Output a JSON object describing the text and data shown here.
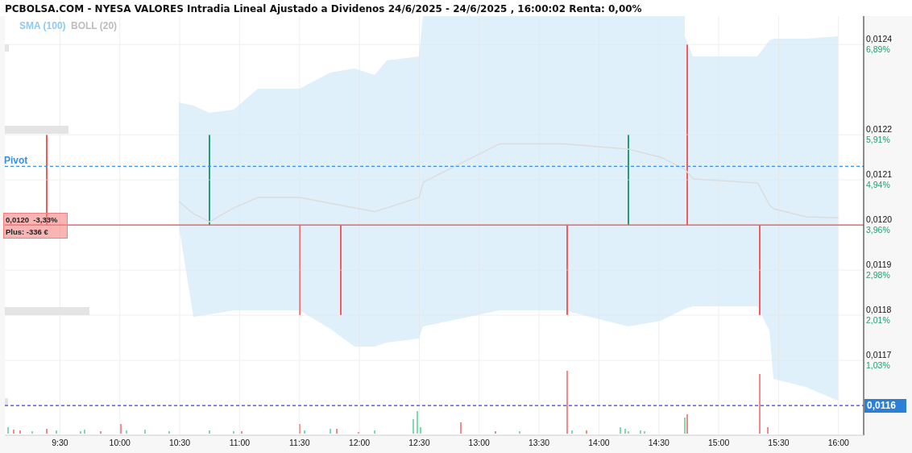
{
  "title": "PCBOLSA.COM - NYESA VALORES Intradia Lineal Ajustado a Dividenos 24/6/2025 - 24/6/2025 , 16:00:02 Renta: 0,00%",
  "legend": [
    {
      "label": "SMA (100)",
      "color": "#8ccbf3"
    },
    {
      "label": "BOLL (20)",
      "color": "#bdbdbd"
    }
  ],
  "chart": {
    "price_tag": {
      "lines": [
        "0,0120  -3,33%",
        "Plus: -336 €"
      ]
    },
    "percent_labels": [
      "6,89%",
      "5,91%",
      "4,94%",
      "3,96%",
      "2,98%",
      "2,01%",
      "1,03%"
    ],
    "chart_data": {
      "type": "line",
      "grid": true,
      "xlim": [
        9.04,
        16.21
      ],
      "ylim": [
        0.011534,
        0.012463
      ],
      "xticks": [
        {
          "value": 9.5,
          "label": "9:30"
        },
        {
          "value": 10,
          "label": "10:00"
        },
        {
          "value": 10.5,
          "label": "10:30"
        },
        {
          "value": 11,
          "label": "11:00"
        },
        {
          "value": 11.5,
          "label": "11:30"
        },
        {
          "value": 12,
          "label": "12:00"
        },
        {
          "value": 12.5,
          "label": "12:30"
        },
        {
          "value": 13,
          "label": "13:00"
        },
        {
          "value": 13.5,
          "label": "13:30"
        },
        {
          "value": 14,
          "label": "14:00"
        },
        {
          "value": 14.5,
          "label": "14:30"
        },
        {
          "value": 15,
          "label": "15:00"
        },
        {
          "value": 15.5,
          "label": "15:30"
        },
        {
          "value": 16,
          "label": "16:00"
        }
      ],
      "yticks": [
        {
          "value": 0.0124,
          "label": "0,0124"
        },
        {
          "value": 0.0122,
          "label": "0,0122"
        },
        {
          "value": 0.0121,
          "label": "0,0121"
        },
        {
          "value": 0.012,
          "label": "0,0120"
        },
        {
          "value": 0.0119,
          "label": "0,0119"
        },
        {
          "value": 0.0118,
          "label": "0,0118"
        },
        {
          "value": 0.0117,
          "label": "0,0117"
        }
      ],
      "x": [
        10.494,
        10.615,
        10.75,
        10.952,
        11.153,
        11.503,
        11.759,
        11.961,
        12.129,
        12.23,
        12.499,
        12.533,
        13.172,
        13.711,
        14.249,
        14.518,
        14.72,
        14.787,
        15.326,
        15.427,
        15.46,
        15.729,
        15.999
      ],
      "series": [
        {
          "color": "#dcdcdc",
          "values": [
            0.012052,
            0.012025,
            0.012007,
            0.012038,
            0.012061,
            0.012061,
            0.012048,
            0.012038,
            0.01203,
            0.012038,
            0.012061,
            0.012095,
            0.01218,
            0.01218,
            0.012168,
            0.01215,
            0.012123,
            0.012102,
            0.012093,
            0.012043,
            0.012036,
            0.012018,
            0.012016
          ]
        }
      ],
      "ref_lines": [
        {
          "axis": "y",
          "value": 0.01213,
          "label": "Pivot",
          "color": "#3d8fe0"
        },
        {
          "axis": "y",
          "value": 0.012,
          "color": "#e05050"
        },
        {
          "axis": "y",
          "value": 0.0116,
          "label": "0,0116",
          "color": "#3b3bf0"
        }
      ]
    }
  }
}
